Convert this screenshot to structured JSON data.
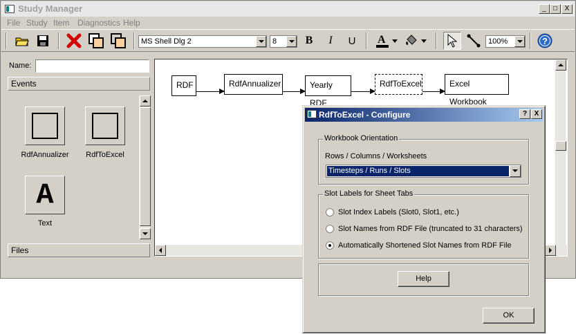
{
  "app": {
    "title": "Study Manager"
  },
  "window_buttons": {
    "minimize": "_",
    "maximize": "□",
    "close": "X"
  },
  "menu": [
    "File",
    "Study",
    "Item",
    "Diagnostics",
    "Help"
  ],
  "toolbar": {
    "font_name": "MS Shell Dlg 2",
    "font_size": "8",
    "bold": "B",
    "italic": "I",
    "underline": "U",
    "zoom": "100%",
    "help": "?"
  },
  "left_panel": {
    "name_label": "Name:",
    "name_value": "",
    "events_label": "Events",
    "files_label": "Files",
    "palette": [
      {
        "label": "RdfAnnualizer",
        "icon": "square-icon"
      },
      {
        "label": "RdfToExcel",
        "icon": "square-icon"
      },
      {
        "label": "Text",
        "icon": "text-icon",
        "glyph": "A"
      }
    ]
  },
  "diagram": {
    "nodes": [
      "RDF",
      "RdfAnnualizer",
      "Yearly RDF",
      "RdfToExcel",
      "Excel Workbook"
    ]
  },
  "dialog": {
    "title": "RdfToExcel - Configure",
    "help_glyph": "?",
    "close_glyph": "X",
    "orientation_group": "Workbook Orientation",
    "orientation_label": "Rows / Columns / Worksheets",
    "orientation_value": "Timesteps / Runs / Slots",
    "slot_group": "Slot Labels for Sheet Tabs",
    "options": [
      {
        "label": "Slot Index Labels (Slot0, Slot1, etc.)",
        "selected": false
      },
      {
        "label": "Slot Names from RDF File (truncated to 31 characters)",
        "selected": false
      },
      {
        "label": "Automatically Shortened Slot Names from RDF File",
        "selected": true
      }
    ],
    "help_button": "Help",
    "ok_button": "OK"
  },
  "colors": {
    "dialog_title_start": "#0a246a",
    "dialog_title_end": "#a6caf0",
    "selection": "#0a246a",
    "delete": "#d40000"
  }
}
